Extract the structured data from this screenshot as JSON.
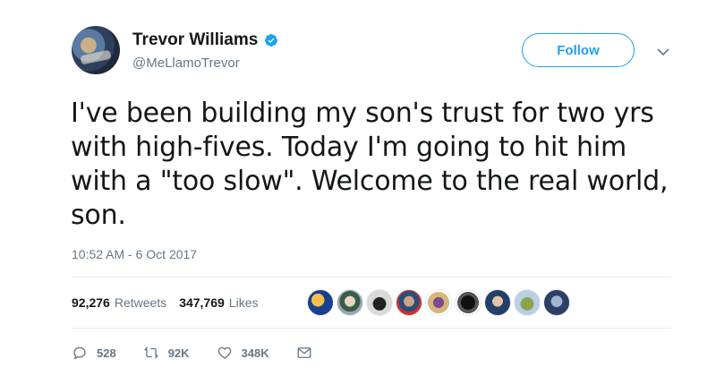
{
  "user": {
    "name": "Trevor Williams",
    "handle": "@MeLlamoTrevor",
    "verified": true
  },
  "follow_label": "Follow",
  "tweet": {
    "lines": [
      "I've been building my son's trust for two yrs",
      "with high-fives. Today I'm going to hit him",
      "with a \"too slow\". Welcome to the real world,",
      "son."
    ],
    "timestamp": "10:52 AM - 6 Oct 2017"
  },
  "stats": {
    "retweets_count": "92,276",
    "retweets_label": "Retweets",
    "likes_count": "347,769",
    "likes_label": "Likes"
  },
  "actions": {
    "reply_count": "528",
    "retweet_count": "92K",
    "like_count": "348K"
  },
  "colors": {
    "accent": "#1da1f2",
    "text": "#14171a",
    "secondary": "#657786"
  }
}
